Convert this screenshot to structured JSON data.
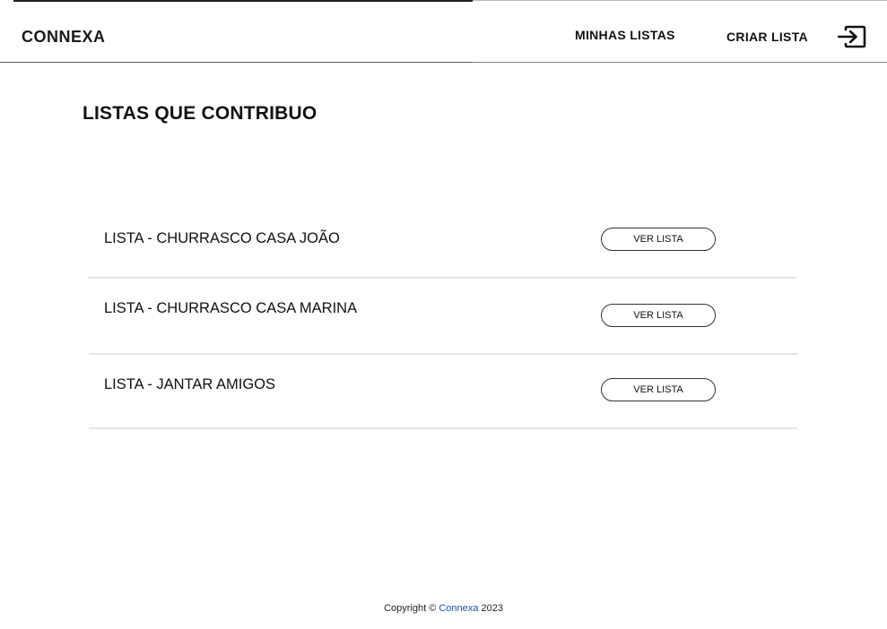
{
  "header": {
    "logo": "CONNEXA",
    "nav": {
      "minhas_listas": "MINHAS LISTAS",
      "criar_lista": "CRIAR LISTA"
    },
    "logout_icon": "logout-arrow-icon"
  },
  "main": {
    "title": "LISTAS QUE CONTRIBUO",
    "lists": [
      {
        "name": "LISTA - CHURRASCO CASA JOÃO",
        "button": "VER LISTA"
      },
      {
        "name": "LISTA - CHURRASCO CASA MARINA",
        "button": "VER LISTA"
      },
      {
        "name": "LISTA - JANTAR AMIGOS",
        "button": "VER LISTA"
      }
    ]
  },
  "footer": {
    "prefix": "Copyright © ",
    "brand": "Connexa",
    "year": " 2023",
    "brand_color": "#1f4fb5"
  }
}
